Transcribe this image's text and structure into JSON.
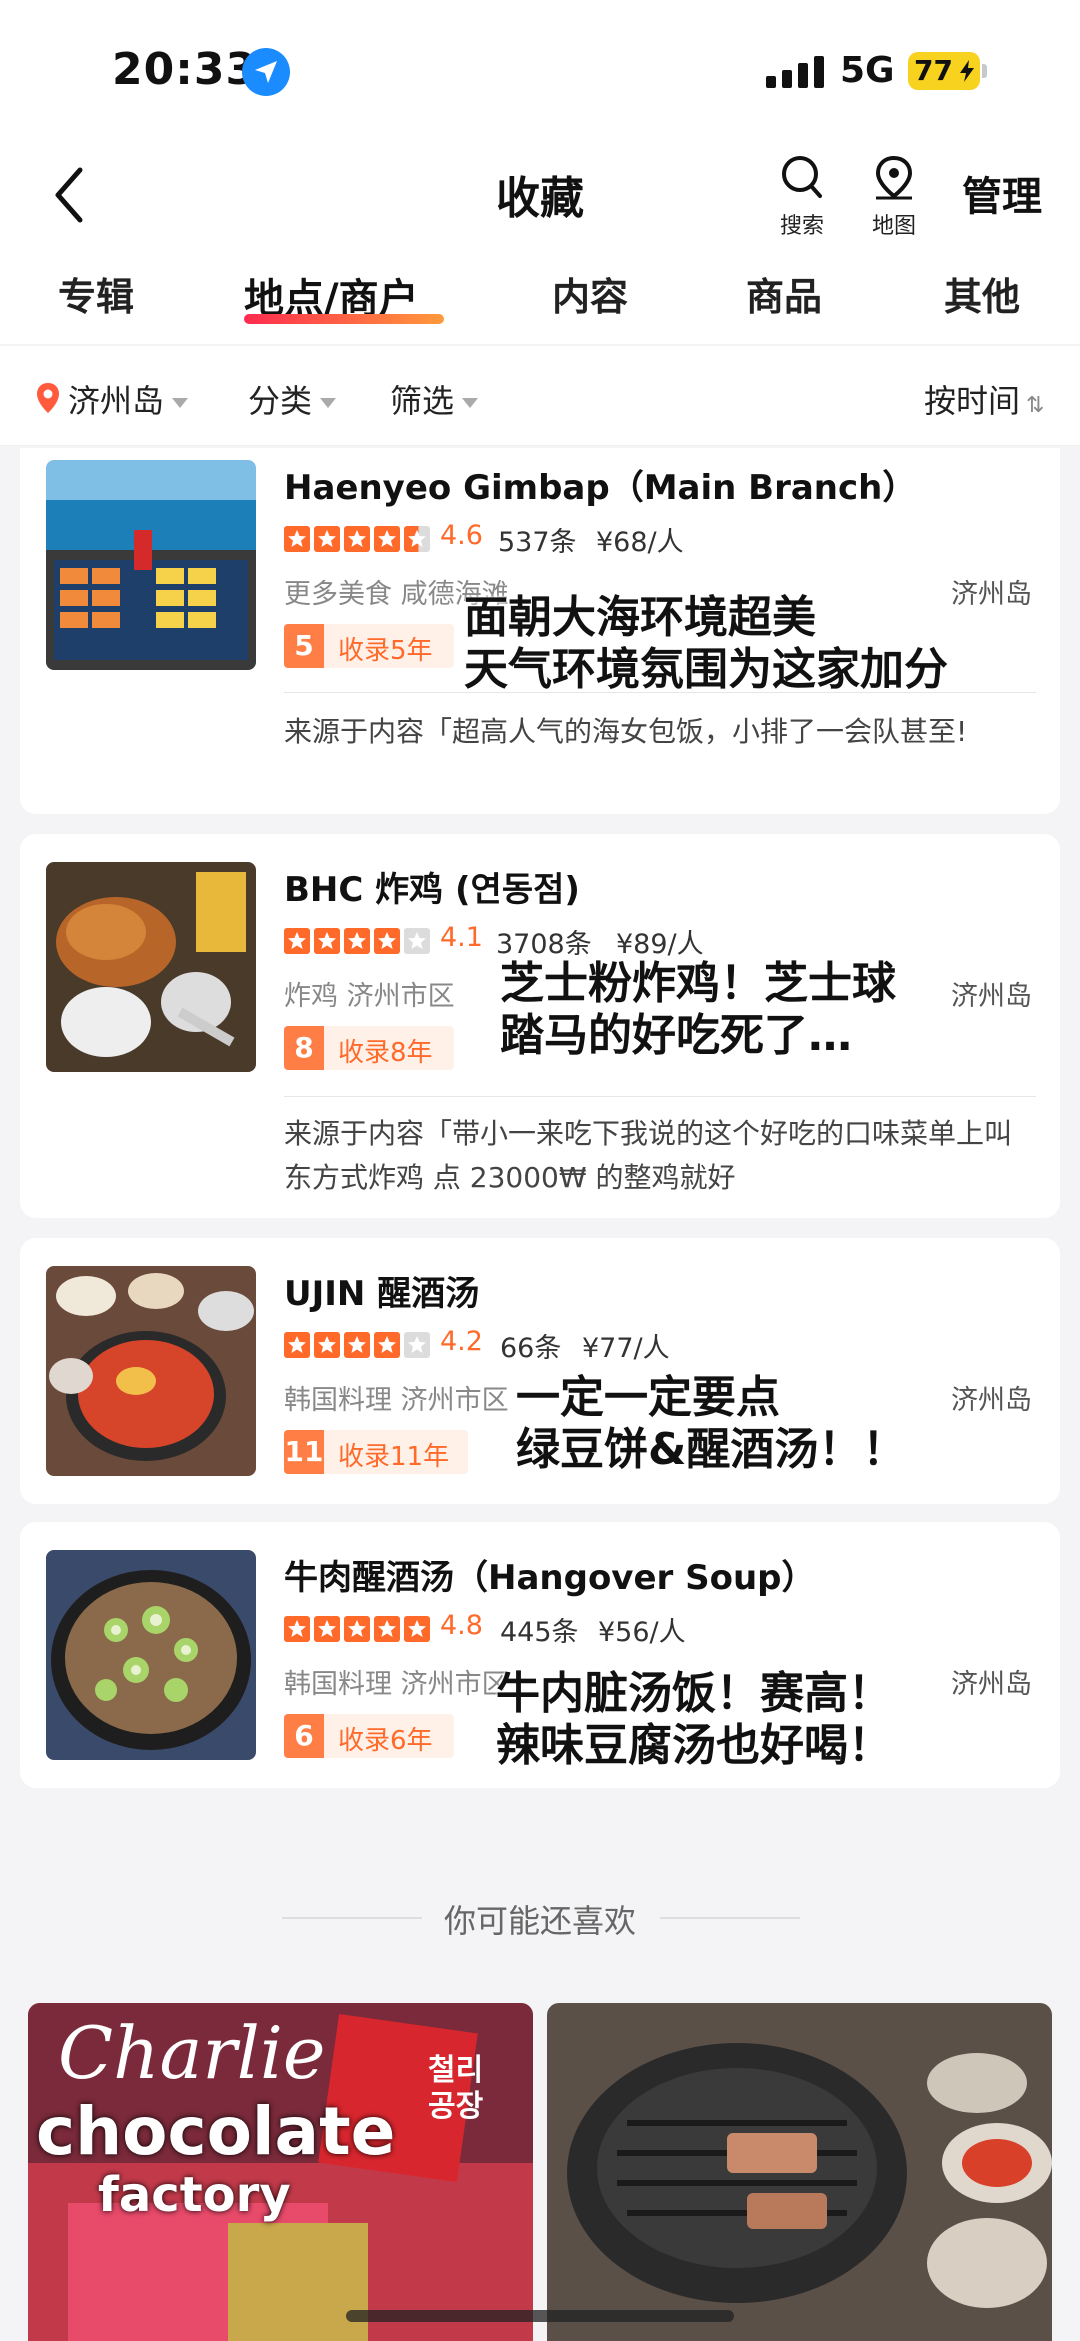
{
  "status_bar": {
    "time": "20:33",
    "network": "5G",
    "battery": "77"
  },
  "nav": {
    "title": "收藏",
    "search_label": "搜索",
    "map_label": "地图",
    "manage_label": "管理"
  },
  "tabs": [
    {
      "label": "专辑"
    },
    {
      "label": "地点/商户",
      "active": true
    },
    {
      "label": "内容"
    },
    {
      "label": "商品"
    },
    {
      "label": "其他"
    }
  ],
  "filters": {
    "location": "济州岛",
    "category": "分类",
    "filter": "筛选",
    "sort": "按时间",
    "sort_icon": "⇅"
  },
  "cards": [
    {
      "title": "Haenyeo Gimbap（Main Branch）",
      "stars": 4.5,
      "rating": "4.6",
      "reviews": "537条",
      "price": "¥68/人",
      "meta": "更多美食 咸德海滩",
      "region": "济州岛",
      "badge_num": "5",
      "badge_text": "收录5年",
      "overlay": [
        "面朝大海环境超美",
        "天气环境氛围为这家加分"
      ],
      "source": "来源于内容「超高人气的海女包饭，小排了一会队甚至!"
    },
    {
      "title": "BHC 炸鸡 (연동점)",
      "stars": 4,
      "rating": "4.1",
      "reviews": "3708条",
      "price": "¥89/人",
      "meta": "炸鸡 济州市区",
      "region": "济州岛",
      "badge_num": "8",
      "badge_text": "收录8年",
      "overlay": [
        "芝士粉炸鸡！芝士球",
        "踏马的好吃死了…"
      ],
      "source": "来源于内容「带小一来吃下我说的这个好吃的口味菜单上叫东方式炸鸡 点 23000₩ 的整鸡就好"
    },
    {
      "title": "UJIN 醒酒汤",
      "stars": 4,
      "rating": "4.2",
      "reviews": "66条",
      "price": "¥77/人",
      "meta": "韩国料理 济州市区",
      "region": "济州岛",
      "badge_num": "11",
      "badge_text": "收录11年",
      "overlay": [
        "一定一定要点",
        "绿豆饼&醒酒汤！！"
      ]
    },
    {
      "title": "牛肉醒酒汤（Hangover Soup）",
      "stars": 5,
      "rating": "4.8",
      "reviews": "445条",
      "price": "¥56/人",
      "meta": "韩国料理 济州市区",
      "region": "济州岛",
      "badge_num": "6",
      "badge_text": "收录6年",
      "overlay": [
        "牛内脏汤饭！赛高！",
        "辣味豆腐汤也好喝！"
      ]
    }
  ],
  "recommend": {
    "label": "你可能还喜欢",
    "left_card_title": [
      "Charlie",
      "chocolate",
      "factory"
    ],
    "left_card_package": [
      "철리",
      "공장"
    ]
  },
  "colors": {
    "accent": "#ff6a2b",
    "tab_gradient_start": "#ff2b4f",
    "tab_gradient_end": "#ff9a3c",
    "location_pin": "#ff5a3c"
  },
  "icons": [
    "navigation-arrow-icon",
    "signal-icon",
    "battery-icon",
    "back-chevron-icon",
    "search-icon",
    "map-pin-icon",
    "location-pin-icon",
    "caret-down-icon",
    "sort-icon",
    "star-icon"
  ]
}
